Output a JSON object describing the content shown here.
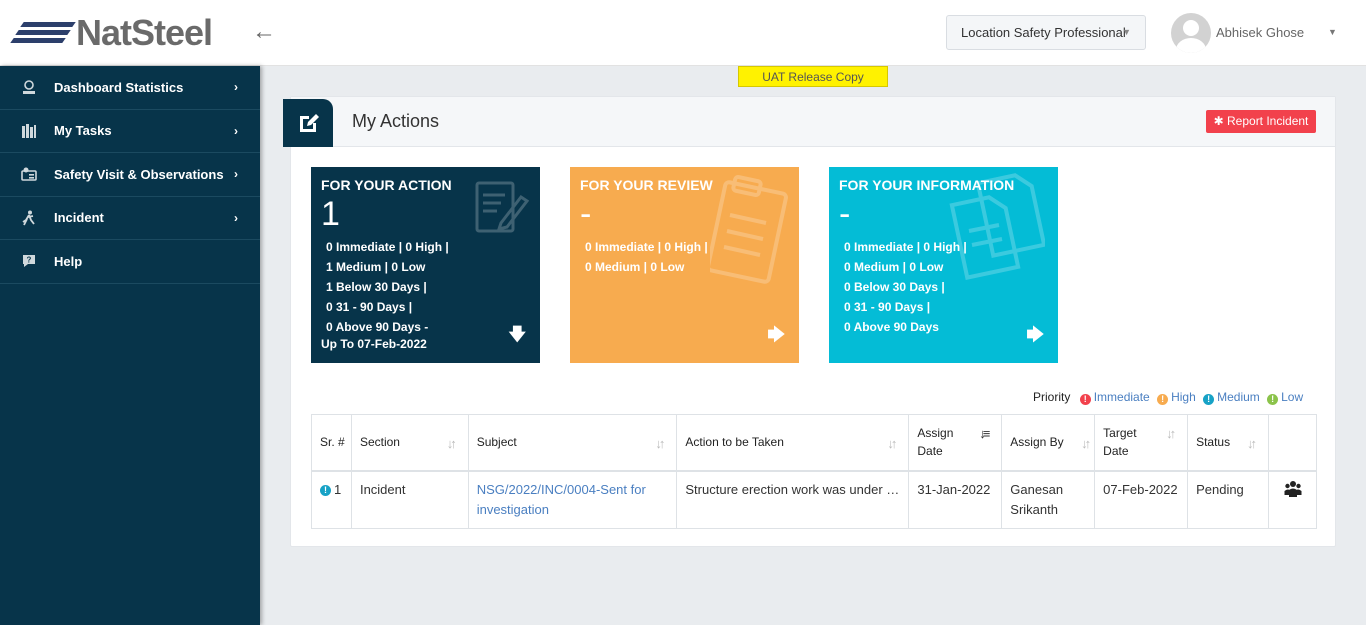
{
  "header": {
    "logo_text": "NatSteel",
    "role_select": {
      "value": "Location Safety Professional"
    },
    "user": {
      "name": "Abhisek Ghose"
    }
  },
  "sidebar": {
    "items": [
      {
        "label": "Dashboard Statistics",
        "icon": "dashboard-icon"
      },
      {
        "label": "My Tasks",
        "icon": "tasks-icon"
      },
      {
        "label": "Safety Visit & Observations",
        "icon": "safety-visit-icon"
      },
      {
        "label": "Incident",
        "icon": "incident-icon"
      },
      {
        "label": "Help",
        "icon": "help-icon"
      }
    ]
  },
  "uat_badge": "UAT Release Copy",
  "panel": {
    "title": "My Actions",
    "report_button": "Report Incident"
  },
  "cards": {
    "action": {
      "title": "FOR YOUR ACTION",
      "count": "1",
      "lines": [
        "0  Immediate  |  0  High  |",
        "1  Medium  |  0  Low",
        "1  Below 30 Days  |",
        "0  31 - 90 Days  |",
        "0  Above 90 Days  -"
      ],
      "footer": "Up To 07-Feb-2022",
      "color": "#07344a"
    },
    "review": {
      "title": "FOR YOUR REVIEW",
      "count": "-",
      "lines": [
        "0  Immediate  |  0  High  |",
        "0  Medium  |  0  Low"
      ],
      "color": "#f7ab4f"
    },
    "information": {
      "title": "FOR YOUR INFORMATION",
      "count": "-",
      "lines": [
        "0  Immediate  |   0  High  |",
        "0  Medium  |  0  Low",
        "0  Below 30 Days  |",
        "0  31 - 90 Days  |",
        "0  Above 90 Days"
      ],
      "color": "#04bcd6"
    }
  },
  "legend": {
    "label": "Priority",
    "items": [
      {
        "text": "Immediate",
        "color": "#f2414c"
      },
      {
        "text": "High",
        "color": "#f7ab4f"
      },
      {
        "text": "Medium",
        "color": "#17a2c6"
      },
      {
        "text": "Low",
        "color": "#8bc34a"
      }
    ]
  },
  "table": {
    "headers": {
      "sr": "Sr. #",
      "section": "Section",
      "subject": "Subject",
      "action": "Action to be Taken",
      "assign_date": "Assign Date",
      "assign_by": "Assign By",
      "target_date": "Target Date",
      "status": "Status"
    },
    "rows": [
      {
        "priority": "Medium",
        "sr": "1",
        "section": "Incident",
        "subject": "NSG/2022/INC/0004-Sent for investigation",
        "action": "Structure erection work was under progress",
        "assign_date": "31-Jan-2022",
        "assign_by": "Ganesan Srikanth",
        "target_date": "07-Feb-2022",
        "status": "Pending"
      }
    ]
  }
}
